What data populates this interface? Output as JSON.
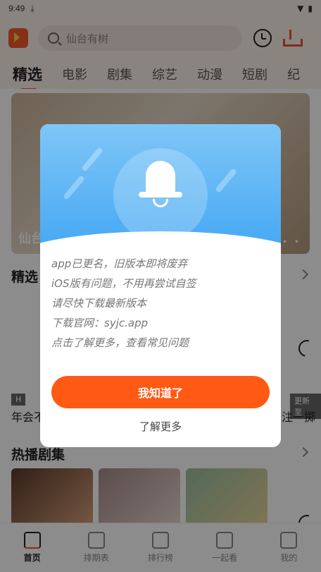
{
  "status_bar": {
    "time": "9:49",
    "download_glyph": "⤓",
    "wifi_glyph": "▼",
    "battery_glyph": "▮"
  },
  "header": {
    "search_placeholder": "仙台有树"
  },
  "tabs": [
    {
      "label": "精选",
      "active": true
    },
    {
      "label": "电影"
    },
    {
      "label": "剧集"
    },
    {
      "label": "综艺"
    },
    {
      "label": "动漫"
    },
    {
      "label": "短剧"
    },
    {
      "label": "纪"
    }
  ],
  "banner": {
    "title": "仙台",
    "dots": "• • •"
  },
  "sections": {
    "featured": "精选",
    "hot_series": "热播剧集"
  },
  "cards": [
    {
      "label": "年会不",
      "tag": "H"
    },
    {
      "label": "狐注一掷",
      "tag": "更新至"
    }
  ],
  "bottom_nav": [
    {
      "label": "首页",
      "icon": "home-icon",
      "active": true
    },
    {
      "label": "排期表",
      "icon": "calendar-icon"
    },
    {
      "label": "排行榜",
      "icon": "chart-icon"
    },
    {
      "label": "一起看",
      "icon": "chat-icon"
    },
    {
      "label": "我的",
      "icon": "user-icon"
    }
  ],
  "dialog": {
    "lines": [
      "app已更名，旧版本即将废弃",
      "iOS版有问题，不用再尝试自签",
      "请尽快下载最新版本",
      "下载官网：syjc.app",
      "点击了解更多，查看常见问题"
    ],
    "primary_button": "我知道了",
    "secondary_button": "了解更多"
  },
  "colors": {
    "accent": "#ff5a14",
    "dialog_blue": "#48a9f3"
  }
}
